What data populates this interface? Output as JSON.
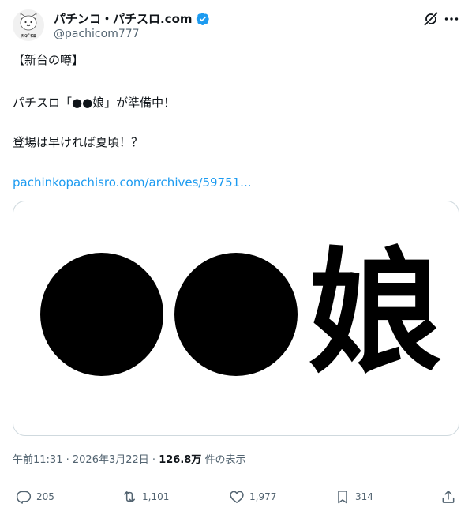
{
  "account": {
    "display_name": "パチンコ・パチスロ.com",
    "handle": "@pachicom777",
    "avatar_caption": "ﾁﾝｺﾊﾟﾁｽﾛ"
  },
  "tweet": {
    "lines": [
      "【新台の噂】",
      "パチスロ「●●娘」が準備中！",
      "登場は早ければ夏頃！？"
    ],
    "link": "pachinkopachisro.com/archives/59751..."
  },
  "media": {
    "image_text": "●●娘"
  },
  "meta": {
    "time": "午前11:31",
    "date": "2026年3月22日",
    "views": "126.8万",
    "views_suffix": "件の表示"
  },
  "actions": {
    "replies": "205",
    "reposts": "1,101",
    "likes": "1,977",
    "bookmarks": "314"
  },
  "icons": {
    "verified": "verified-badge",
    "grok": "grok-icon",
    "more": "more-icon",
    "reply": "reply-icon",
    "repost": "repost-icon",
    "like": "heart-icon",
    "bookmark": "bookmark-icon",
    "share": "share-icon"
  },
  "colors": {
    "accent": "#1d9bf0",
    "text": "#0f1419",
    "secondary": "#536471",
    "border": "#cfd9de"
  }
}
